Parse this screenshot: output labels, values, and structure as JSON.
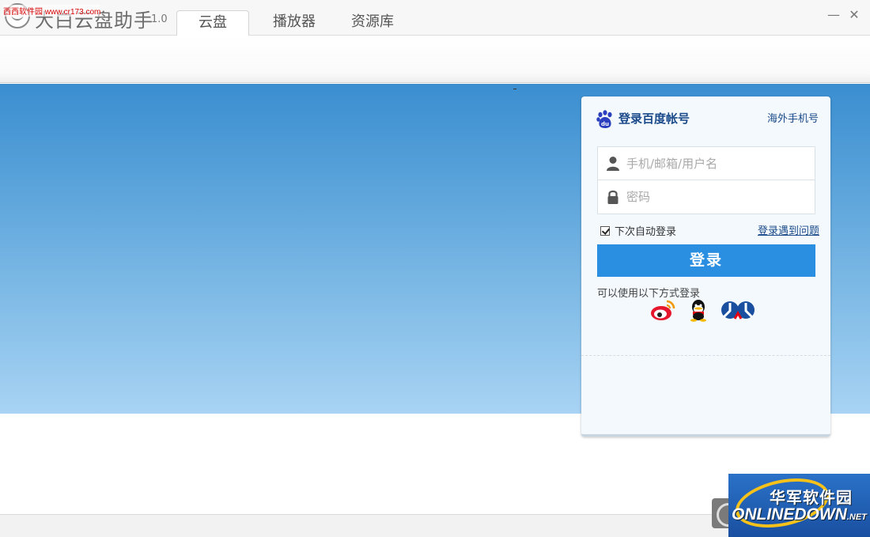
{
  "app": {
    "title": "大白云盘助手",
    "version": "1.0",
    "watermark_top": "西西软件园 www.cr173.com"
  },
  "tabs": [
    {
      "label": "云盘",
      "active": true
    },
    {
      "label": "播放器",
      "active": false
    },
    {
      "label": "资源库",
      "active": false
    }
  ],
  "window": {
    "minimize_glyph": "—",
    "close_glyph": "✕"
  },
  "login": {
    "title": "登录百度帐号",
    "overseas_link": "海外手机号",
    "username_placeholder": "手机/邮箱/用户名",
    "password_placeholder": "密码",
    "remember_label": "下次自动登录",
    "remember_checked": true,
    "problem_link": "登录遇到问题",
    "submit_label": "登录",
    "alt_login_label": "可以使用以下方式登录",
    "alt_providers": [
      "weibo-icon",
      "qq-icon",
      "renren-icon"
    ],
    "accent_color": "#2a8fe0"
  },
  "watermark": {
    "cn": "华军软件园",
    "en": "ONLINEDOWN",
    "net": ".NET"
  }
}
